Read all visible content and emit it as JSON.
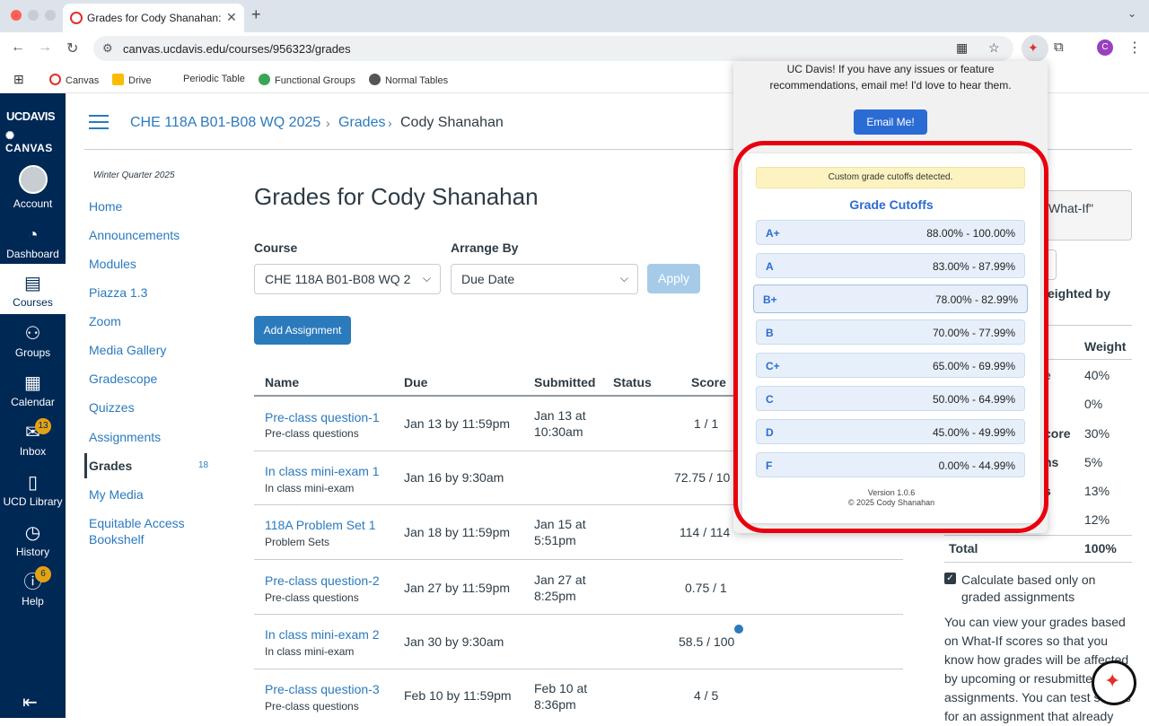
{
  "browser": {
    "tab_title": "Grades for Cody Shanahan: C",
    "tab_close": "✕",
    "new_tab": "+",
    "tab_menu": "⌄",
    "url": "canvas.ucdavis.edu/courses/956323/grades",
    "profile_initial": "C",
    "bookmarks": [
      "Canvas",
      "Drive",
      "Periodic Table",
      "Functional Groups",
      "Normal Tables"
    ]
  },
  "global_nav": {
    "logo_line1": "UCDAVIS",
    "logo_line2": "✺ CANVAS",
    "items": [
      "Account",
      "Dashboard",
      "Courses",
      "Groups",
      "Calendar",
      "Inbox",
      "UCD Library",
      "History",
      "Help"
    ],
    "inbox_badge": "13",
    "help_badge": "6"
  },
  "breadcrumb": {
    "course": "CHE 118A B01-B08 WQ 2025",
    "section": "Grades",
    "student": "Cody Shanahan",
    "separator": "›"
  },
  "course_nav": {
    "term": "Winter Quarter 2025",
    "items": [
      "Home",
      "Announcements",
      "Modules",
      "Piazza 1.3",
      "Zoom",
      "Media Gallery",
      "Gradescope",
      "Quizzes",
      "Assignments",
      "Grades",
      "My Media",
      "Equitable Access",
      "Bookshelf"
    ],
    "grades_count": "18"
  },
  "main": {
    "title": "Grades for Cody Shanahan",
    "course_label": "Course",
    "course_value": "CHE 118A B01-B08 WQ 2",
    "arrange_label": "Arrange By",
    "arrange_value": "Due Date",
    "apply": "Apply",
    "add_assignment": "Add Assignment",
    "columns": [
      "Name",
      "Due",
      "Submitted",
      "Status",
      "Score"
    ],
    "rows": [
      {
        "name": "Pre-class question-1",
        "group": "Pre-class questions",
        "due": "Jan 13 by 11:59pm",
        "submitted1": "Jan 13 at",
        "submitted2": "10:30am",
        "score": "1 / 1"
      },
      {
        "name": "In class mini-exam 1",
        "group": "In class mini-exam",
        "due": "Jan 16 by 9:30am",
        "submitted1": "",
        "submitted2": "",
        "score": "72.75 / 10"
      },
      {
        "name": "118A Problem Set 1",
        "group": "Problem Sets",
        "due": "Jan 18 by 11:59pm",
        "submitted1": "Jan 15 at",
        "submitted2": "5:51pm",
        "score": "114 / 114"
      },
      {
        "name": "Pre-class question-2",
        "group": "Pre-class questions",
        "due": "Jan 27 by 11:59pm",
        "submitted1": "Jan 27 at",
        "submitted2": "8:25pm",
        "score": "0.75 / 1"
      },
      {
        "name": "In class mini-exam 2",
        "group": "In class mini-exam",
        "due": "Jan 30 by 9:30am",
        "submitted1": "",
        "submitted2": "",
        "score": "58.5 / 100"
      },
      {
        "name": "Pre-class question-3",
        "group": "Pre-class questions",
        "due": "Feb 10 by 11:59pm",
        "submitted1": "Feb 10 at",
        "submitted2": "8:36pm",
        "score": "4 / 5"
      }
    ]
  },
  "sidebar": {
    "whatif_fragment": "What-If\"",
    "weighted_fragment": "eighted by",
    "weight_header": "Weight",
    "weights": [
      {
        "frag": "e",
        "weight": "40%"
      },
      {
        "frag": "",
        "weight": "0%"
      },
      {
        "frag": "core",
        "weight": "30%"
      },
      {
        "frag": "ns",
        "weight": "5%"
      },
      {
        "frag": "s",
        "weight": "13%"
      },
      {
        "frag": "",
        "weight": "12%"
      }
    ],
    "total_label": "Total",
    "total_value": "100%",
    "checkbox_label_1": "Calculate based only on",
    "checkbox_label_2": "graded assignments",
    "paragraph": "You can view your grades based on What-If scores so that you know how grades will be affected by upcoming or resubmitted assignments. You can test scores for an assignment that already"
  },
  "popup": {
    "intro_1": "UC Davis! If you have any issues or feature",
    "intro_2": "recommendations, email me! I'd love to hear them.",
    "email_button": "Email Me!",
    "notice": "Custom grade cutoffs detected.",
    "title": "Grade Cutoffs",
    "cutoffs": [
      {
        "grade": "A+",
        "range": "88.00% - 100.00%"
      },
      {
        "grade": "A",
        "range": "83.00% - 87.99%"
      },
      {
        "grade": "B+",
        "range": "78.00% - 82.99%"
      },
      {
        "grade": "B",
        "range": "70.00% - 77.99%"
      },
      {
        "grade": "C+",
        "range": "65.00% - 69.99%"
      },
      {
        "grade": "C",
        "range": "50.00% - 64.99%"
      },
      {
        "grade": "D",
        "range": "45.00% - 49.99%"
      },
      {
        "grade": "F",
        "range": "0.00% - 44.99%"
      }
    ],
    "version": "Version 1.0.6",
    "copyright": "© 2025 Cody Shanahan"
  },
  "colors": {
    "canvas_nav": "#002855",
    "link": "#2b7abc",
    "highlight": "#e8000e",
    "badge": "#e3a214"
  }
}
